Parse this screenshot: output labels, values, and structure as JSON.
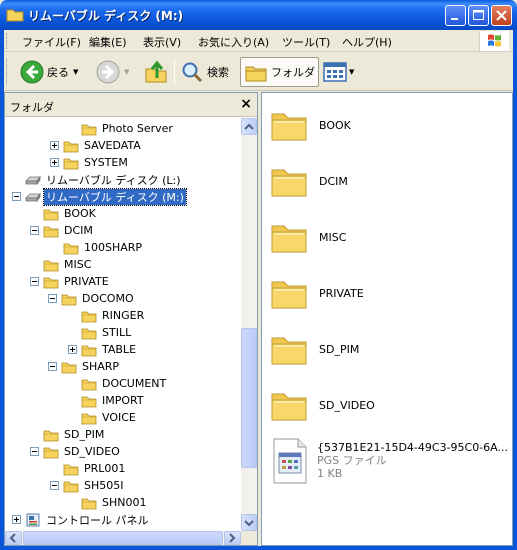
{
  "window": {
    "title": "リムーバブル ディスク (M:)",
    "colors": {
      "titlebar": "#0a55d8",
      "selection": "#316ac5"
    }
  },
  "menu": [
    {
      "label": "ファイル(F)"
    },
    {
      "label": "編集(E)"
    },
    {
      "label": "表示(V)"
    },
    {
      "label": "お気に入り(A)"
    },
    {
      "label": "ツール(T)"
    },
    {
      "label": "ヘルプ(H)"
    }
  ],
  "toolbar": {
    "back": "戻る",
    "search": "検索",
    "folders": "フォルダ"
  },
  "folder_pane": {
    "title": "フォルダ",
    "close": "×",
    "tree": [
      {
        "label": "Photo Server",
        "toggle": "none",
        "icon": "folder-icon",
        "selected": false
      },
      {
        "label": "SAVEDATA",
        "toggle": "plus",
        "icon": "folder-icon",
        "selected": false
      },
      {
        "label": "SYSTEM",
        "toggle": "plus",
        "icon": "folder-icon",
        "selected": false
      },
      {
        "label": "リムーバブル ディスク (L:)",
        "toggle": "none",
        "icon": "removable-disk-icon",
        "selected": false
      },
      {
        "label": "リムーバブル ディスク (M:)",
        "toggle": "minus",
        "icon": "removable-disk-icon",
        "selected": true
      },
      {
        "label": "BOOK",
        "toggle": "none",
        "icon": "folder-icon",
        "selected": false
      },
      {
        "label": "DCIM",
        "toggle": "minus",
        "icon": "folder-icon",
        "selected": false
      },
      {
        "label": "100SHARP",
        "toggle": "none",
        "icon": "folder-icon",
        "selected": false
      },
      {
        "label": "MISC",
        "toggle": "none",
        "icon": "folder-icon",
        "selected": false
      },
      {
        "label": "PRIVATE",
        "toggle": "minus",
        "icon": "folder-icon",
        "selected": false
      },
      {
        "label": "DOCOMO",
        "toggle": "minus",
        "icon": "folder-icon",
        "selected": false
      },
      {
        "label": "RINGER",
        "toggle": "none",
        "icon": "folder-icon",
        "selected": false
      },
      {
        "label": "STILL",
        "toggle": "none",
        "icon": "folder-icon",
        "selected": false
      },
      {
        "label": "TABLE",
        "toggle": "plus",
        "icon": "folder-icon",
        "selected": false
      },
      {
        "label": "SHARP",
        "toggle": "minus",
        "icon": "folder-icon",
        "selected": false
      },
      {
        "label": "DOCUMENT",
        "toggle": "none",
        "icon": "folder-icon",
        "selected": false
      },
      {
        "label": "IMPORT",
        "toggle": "none",
        "icon": "folder-icon",
        "selected": false
      },
      {
        "label": "VOICE",
        "toggle": "none",
        "icon": "folder-icon",
        "selected": false
      },
      {
        "label": "SD_PIM",
        "toggle": "none",
        "icon": "folder-icon",
        "selected": false
      },
      {
        "label": "SD_VIDEO",
        "toggle": "minus",
        "icon": "folder-icon",
        "selected": false
      },
      {
        "label": "PRL001",
        "toggle": "none",
        "icon": "folder-icon",
        "selected": false
      },
      {
        "label": "SH505I",
        "toggle": "minus",
        "icon": "folder-icon",
        "selected": false
      },
      {
        "label": "SHN001",
        "toggle": "none",
        "icon": "folder-icon",
        "selected": false
      },
      {
        "label": "コントロール パネル",
        "toggle": "plus",
        "icon": "control-panel-icon",
        "selected": false
      }
    ]
  },
  "files": [
    {
      "name": "BOOK"
    },
    {
      "name": "DCIM"
    },
    {
      "name": "MISC"
    },
    {
      "name": "PRIVATE"
    },
    {
      "name": "SD_PIM"
    },
    {
      "name": "SD_VIDEO"
    }
  ],
  "pgs_file": {
    "name": "{537B1E21-15D4-49C3-95C0-6A...",
    "type": "PGS ファイル",
    "size": "1 KB"
  }
}
